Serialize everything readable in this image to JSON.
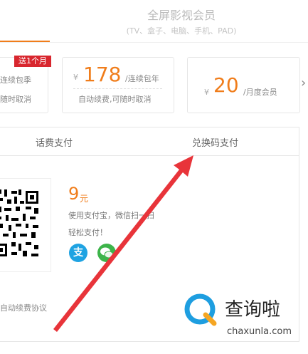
{
  "header": {
    "tab_title": "全屏影视会员",
    "tab_subtitle": "(TV、盒子、电脑、手机、PAD)"
  },
  "plans": [
    {
      "badge": "送1个月",
      "unit": "连续包季",
      "desc": "随时取消"
    },
    {
      "currency": "¥",
      "price": "178",
      "unit": "/连续包年",
      "desc": "自动续费,可随时取消"
    },
    {
      "currency": "¥",
      "price": "20",
      "unit": "/月度会员"
    }
  ],
  "pay": {
    "tab_left": "话费支付",
    "tab_right": "兑换码支付",
    "amount": "9",
    "amount_unit": "元",
    "instruction_line1": "使用支付宝，微信扫一扫",
    "instruction_line2": "轻松支付！",
    "alipay_glyph": "支",
    "agreement": "自动续费协议"
  },
  "watermark": {
    "text": "查询啦",
    "url": "chaxunla.com"
  },
  "colors": {
    "accent": "#f07d1b",
    "promo": "#d8262e",
    "arrow": "#e8343a",
    "alipay": "#1fa3e2",
    "wechat": "#3db44a"
  }
}
